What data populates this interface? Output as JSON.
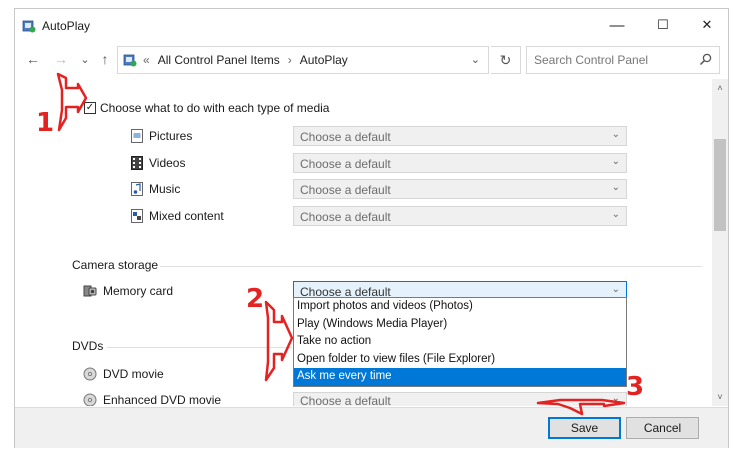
{
  "window": {
    "title": "AutoPlay",
    "controls": {
      "minimize": "—",
      "maximize": "☐",
      "close": "✕"
    }
  },
  "nav": {
    "back": "←",
    "forward": "→",
    "recent": "⌄",
    "up": "↑",
    "address": {
      "overflow": "«",
      "crumbs": [
        "All Control Panel Items",
        "AutoPlay"
      ],
      "separator": "›",
      "dropdown": "⌄"
    },
    "refresh": "↻",
    "search_placeholder": "Search Control Panel",
    "search_icon": "⚲"
  },
  "options": {
    "use_autoplay_label": "Choose what to do with each type of media",
    "use_autoplay_checked": true,
    "media": [
      {
        "label": "Pictures",
        "value": "Choose a default",
        "icon": "pictures-icon"
      },
      {
        "label": "Videos",
        "value": "Choose a default",
        "icon": "videos-icon"
      },
      {
        "label": "Music",
        "value": "Choose a default",
        "icon": "music-icon"
      },
      {
        "label": "Mixed content",
        "value": "Choose a default",
        "icon": "mixed-content-icon"
      }
    ],
    "camera_storage": {
      "heading": "Camera storage",
      "label": "Memory card",
      "value": "Choose a default",
      "dropdown_items": [
        "Import photos and videos (Photos)",
        "Play (Windows Media Player)",
        "Take no action",
        "Open folder to view files (File Explorer)",
        "Ask me every time"
      ],
      "highlighted_index": 4
    },
    "dvds": {
      "heading": "DVDs",
      "items": [
        {
          "label": "DVD movie",
          "icon": "dvd-icon"
        },
        {
          "label": "Enhanced DVD movie",
          "value": "Choose a default",
          "icon": "dvd-icon"
        }
      ]
    }
  },
  "scroll": {
    "up": "˄",
    "down": "˅"
  },
  "chevron": "⌄",
  "footer": {
    "save": "Save",
    "cancel": "Cancel"
  },
  "annotations": {
    "step1": "1",
    "step2": "2",
    "step3": "3",
    "color": "#e32222"
  },
  "colors": {
    "accent": "#0078d7",
    "highlight": "#0078d7"
  }
}
